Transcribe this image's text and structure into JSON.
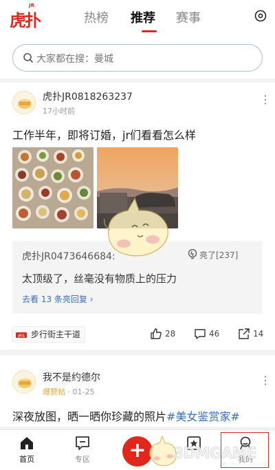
{
  "app": {
    "logo_text": "虎扑",
    "logo_jr": "JR",
    "brand_color": "#e1261c",
    "link_color": "#3b6fb6"
  },
  "top_tabs": [
    {
      "label": "热榜",
      "active": false
    },
    {
      "label": "推荐",
      "active": true
    },
    {
      "label": "赛事",
      "active": false
    }
  ],
  "top_right_icon": "settings-circle-icon",
  "search": {
    "placeholder": "大家都在搜：曼城",
    "icon": "search-icon"
  },
  "posts": [
    {
      "username": "虎扑JR0818263237",
      "time": "17小时前",
      "text": "工作半年，即将订婚，jr们看看怎么样",
      "images": [
        "food-table-photo",
        "sunset-car-photo"
      ],
      "top_reply": {
        "username": "虎扑JR0473646684:",
        "like_label": "亮了[237]",
        "text": "太顶级了，丝毫没有物质上的压力",
        "more_link": "去看 13 条亮回复 ›"
      },
      "source": "步行街主干道",
      "likes": "28",
      "comments": "46",
      "shares": "14"
    },
    {
      "username": "我不是约德尔",
      "badge": "爆赞帖",
      "time": "· 01-25",
      "text": "深夜放图，晒一晒你珍藏的照片",
      "tag": "#美女鉴赏家#"
    }
  ],
  "bottom_nav": [
    {
      "label": "首页",
      "icon": "home-icon",
      "active": true
    },
    {
      "label": "专区",
      "icon": "chat-square-icon",
      "active": false
    },
    {
      "label": "+",
      "icon": "plus-icon",
      "active": false
    },
    {
      "label": "",
      "icon": "star-square-icon",
      "active": false
    },
    {
      "label": "我的",
      "icon": "profile-icon",
      "active": false
    }
  ],
  "watermark": "3DMGAME"
}
